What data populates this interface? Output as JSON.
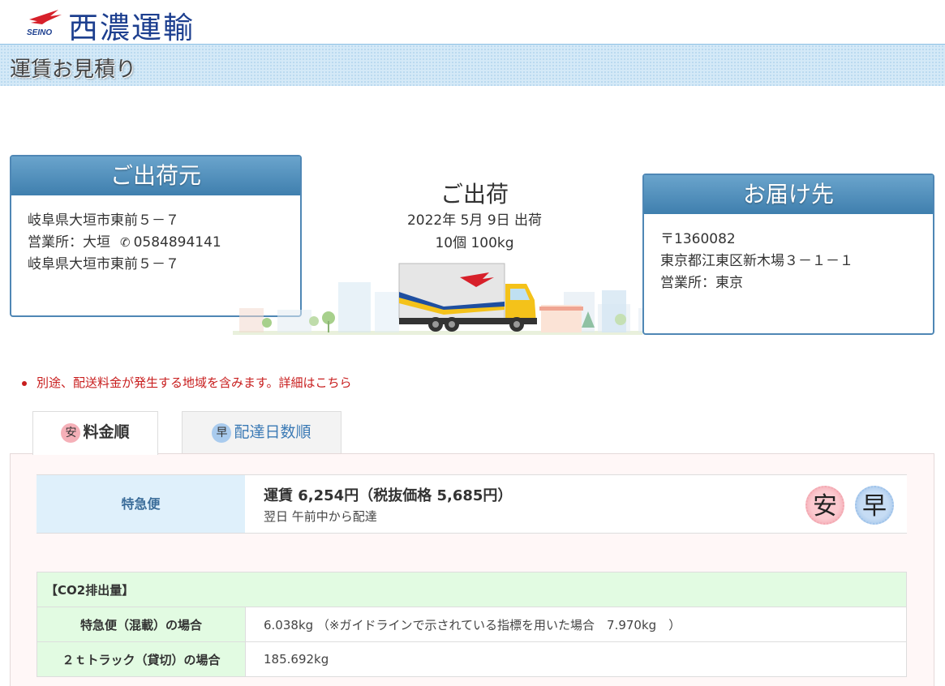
{
  "header": {
    "logo_sub": "SEINO",
    "company_name": "西濃運輸",
    "page_title": "運賃お見積り"
  },
  "origin": {
    "title": "ご出荷元",
    "address": "岐阜県大垣市東前５－７",
    "office": "営業所：大垣",
    "phone": "0584894141",
    "address2": "岐阜県大垣市東前５－７"
  },
  "shipment": {
    "title": "ご出荷",
    "date": "2022年 5月 9日 出荷",
    "quantity": "10個 100kg"
  },
  "destination": {
    "title": "お届け先",
    "postal": "〒1360082",
    "address": "東京都江東区新木場３－１－１",
    "office": "営業所：東京"
  },
  "notice": "別途、配送料金が発生する地域を含みます。詳細はこちら",
  "tabs": [
    {
      "badge": "安",
      "label": "料金順",
      "active": true
    },
    {
      "badge": "早",
      "label": "配達日数順",
      "active": false
    }
  ],
  "result": {
    "service": "特急便",
    "price": "運賃 6,254円（税抜価格 5,685円）",
    "delivery": "翌日 午前中から配達",
    "seal_cheap": "安",
    "seal_fast": "早"
  },
  "co2": {
    "header": "【CO2排出量】",
    "rows": [
      {
        "label": "特急便（混載）の場合",
        "value": "6.038kg （※ガイドラインで示されている指標を用いた場合　7.970kg　）"
      },
      {
        "label": "２ｔトラック（貸切）の場合",
        "value": "185.692kg"
      }
    ]
  },
  "colors": {
    "brand_blue": "#1d3f8f",
    "panel_blue": "#4f87b5",
    "notice_red": "#c81e1e",
    "co2_green": "#e2fbe2"
  }
}
